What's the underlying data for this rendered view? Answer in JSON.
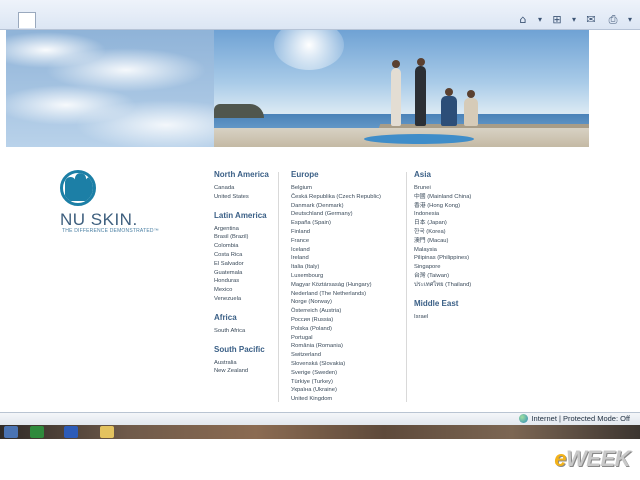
{
  "toolbar": {
    "icons": [
      "home-icon",
      "feeds-icon",
      "mail-icon",
      "print-icon"
    ]
  },
  "status": {
    "zone": "Internet | Protected Mode: Off"
  },
  "logo": {
    "name": "NU SKIN.",
    "tagline": "THE DIFFERENCE DEMONSTRATED™"
  },
  "regions": {
    "north_america": {
      "title": "North America",
      "countries": [
        "Canada",
        "United States"
      ]
    },
    "latin_america": {
      "title": "Latin America",
      "countries": [
        "Argentina",
        "Brasil (Brazil)",
        "Colombia",
        "Costa Rica",
        "El Salvador",
        "Guatemala",
        "Honduras",
        "Mexico",
        "Venezuela"
      ]
    },
    "africa": {
      "title": "Africa",
      "countries": [
        "South Africa"
      ]
    },
    "south_pacific": {
      "title": "South Pacific",
      "countries": [
        "Australia",
        "New Zealand"
      ]
    },
    "europe": {
      "title": "Europe",
      "countries": [
        "Belgium",
        "Česká Republika (Czech Republic)",
        "Danmark (Denmark)",
        "Deutschland (Germany)",
        "España (Spain)",
        "Finland",
        "France",
        "Iceland",
        "Ireland",
        "Italia (Italy)",
        "Luxembourg",
        "Magyar Köztársaság (Hungary)",
        "Nederland (The Netherlands)",
        "Norge (Norway)",
        "Österreich (Austria)",
        "Россия (Russia)",
        "Polska (Poland)",
        "Portugal",
        "România (Romania)",
        "Switzerland",
        "Slovenská (Slovakia)",
        "Sverige (Sweden)",
        "Türkiye (Turkey)",
        "Україна (Ukraine)",
        "United Kingdom"
      ]
    },
    "asia": {
      "title": "Asia",
      "countries": [
        "Brunei",
        "中國 (Mainland China)",
        "香港 (Hong Kong)",
        "Indonesia",
        "日本 (Japan)",
        "한국 (Korea)",
        "澳門 (Macau)",
        "Malaysia",
        "Pilipinas (Philippines)",
        "Singapore",
        "台灣 (Taiwan)",
        "ประเทศไทย (Thailand)"
      ]
    },
    "middle_east": {
      "title": "Middle East",
      "countries": [
        "Israel"
      ]
    }
  },
  "watermark": {
    "e": "e",
    "rest": "WEEK"
  }
}
